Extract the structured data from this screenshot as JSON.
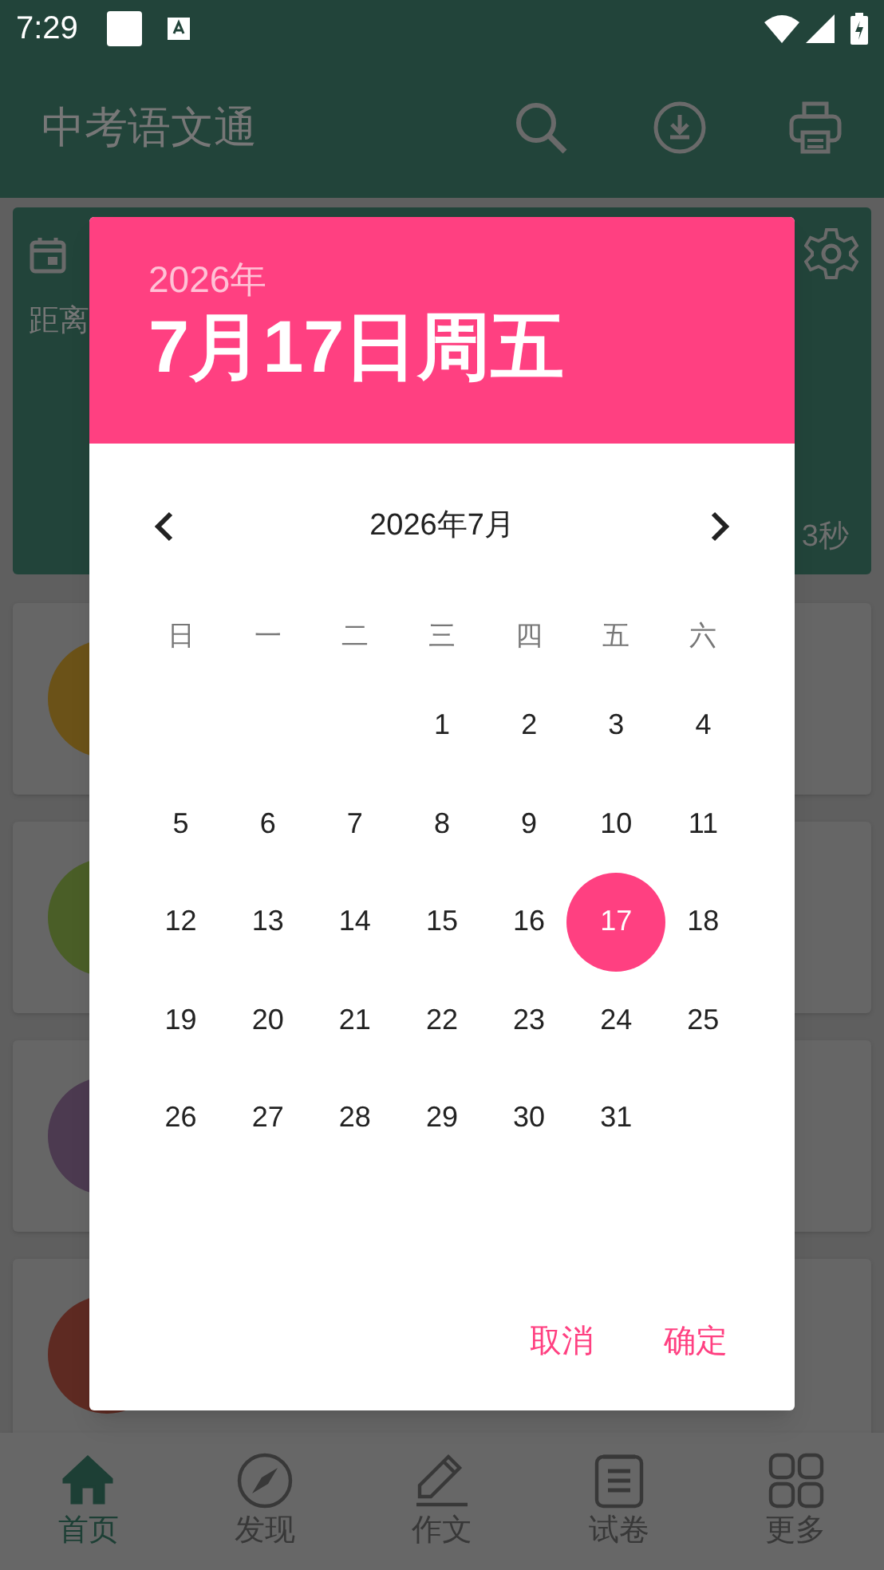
{
  "status_bar": {
    "time": "7:29"
  },
  "app_bar": {
    "title": "中考语文通"
  },
  "countdown_card": {
    "label": "距离",
    "timer": "3秒"
  },
  "list_cards": [
    {
      "color": "#6b5218"
    },
    {
      "color": "#4a5e27"
    },
    {
      "color": "#4c3a50"
    },
    {
      "color": "#5e2a22"
    }
  ],
  "date_picker": {
    "year": "2026年",
    "date": "7月17日周五",
    "month": "2026年7月",
    "weekdays": [
      "日",
      "一",
      "二",
      "三",
      "四",
      "五",
      "六"
    ],
    "weeks": [
      [
        {
          "label": "1",
          "selected": false
        },
        {
          "label": "2",
          "selected": false
        },
        {
          "label": "3",
          "selected": false
        },
        {
          "label": "4",
          "selected": false
        }
      ],
      [
        {
          "label": "5",
          "selected": false
        },
        {
          "label": "6",
          "selected": false
        },
        {
          "label": "7",
          "selected": false
        },
        {
          "label": "8",
          "selected": false
        },
        {
          "label": "9",
          "selected": false
        },
        {
          "label": "10",
          "selected": false
        },
        {
          "label": "11",
          "selected": false
        }
      ],
      [
        {
          "label": "12",
          "selected": false
        },
        {
          "label": "13",
          "selected": false
        },
        {
          "label": "14",
          "selected": false
        },
        {
          "label": "15",
          "selected": false
        },
        {
          "label": "16",
          "selected": false
        },
        {
          "label": "17",
          "selected": true
        },
        {
          "label": "18",
          "selected": false
        }
      ],
      [
        {
          "label": "19",
          "selected": false
        },
        {
          "label": "20",
          "selected": false
        },
        {
          "label": "21",
          "selected": false
        },
        {
          "label": "22",
          "selected": false
        },
        {
          "label": "23",
          "selected": false
        },
        {
          "label": "24",
          "selected": false
        },
        {
          "label": "25",
          "selected": false
        }
      ],
      [
        {
          "label": "26",
          "selected": false
        },
        {
          "label": "27",
          "selected": false
        },
        {
          "label": "28",
          "selected": false
        },
        {
          "label": "29",
          "selected": false
        },
        {
          "label": "30",
          "selected": false
        },
        {
          "label": "31",
          "selected": false
        }
      ]
    ],
    "buttons": [
      "取消",
      "确定"
    ]
  },
  "bottom_nav": [
    {
      "label": "首页",
      "selected": true,
      "kind": "home"
    },
    {
      "label": "发现",
      "selected": false,
      "kind": "compass"
    },
    {
      "label": "作文",
      "selected": false,
      "kind": "pencil"
    },
    {
      "label": "试卷",
      "selected": false,
      "kind": "clipboard"
    },
    {
      "label": "更多",
      "selected": false,
      "kind": "grid"
    }
  ]
}
